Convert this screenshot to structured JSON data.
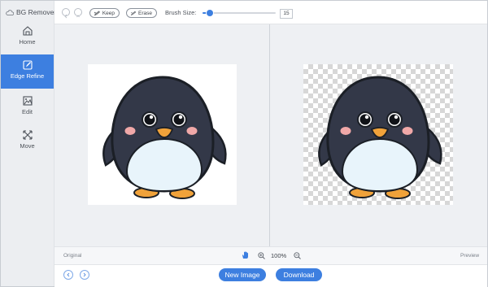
{
  "app": {
    "title": "BG Remover"
  },
  "sidebar": {
    "items": [
      {
        "label": "Home",
        "icon": "home-icon",
        "active": false
      },
      {
        "label": "Edge Refine",
        "icon": "edge-refine-icon",
        "active": true
      },
      {
        "label": "Edit",
        "icon": "image-edit-icon",
        "active": false
      },
      {
        "label": "Move",
        "icon": "move-icon",
        "active": false
      }
    ]
  },
  "toolbar": {
    "keep_label": "Keep",
    "erase_label": "Erase",
    "brush_size_label": "Brush Size:",
    "brush_size_value": "15",
    "brush_slider_fraction": 0.1
  },
  "canvas": {
    "original_label": "Original",
    "preview_label": "Preview",
    "zoom_level": "100%"
  },
  "bottom": {
    "new_image_label": "New Image",
    "download_label": "Download"
  },
  "colors": {
    "accent": "#3d7fe0",
    "sidebar_bg": "#eceef1",
    "canvas_bg": "#eef0f3"
  }
}
